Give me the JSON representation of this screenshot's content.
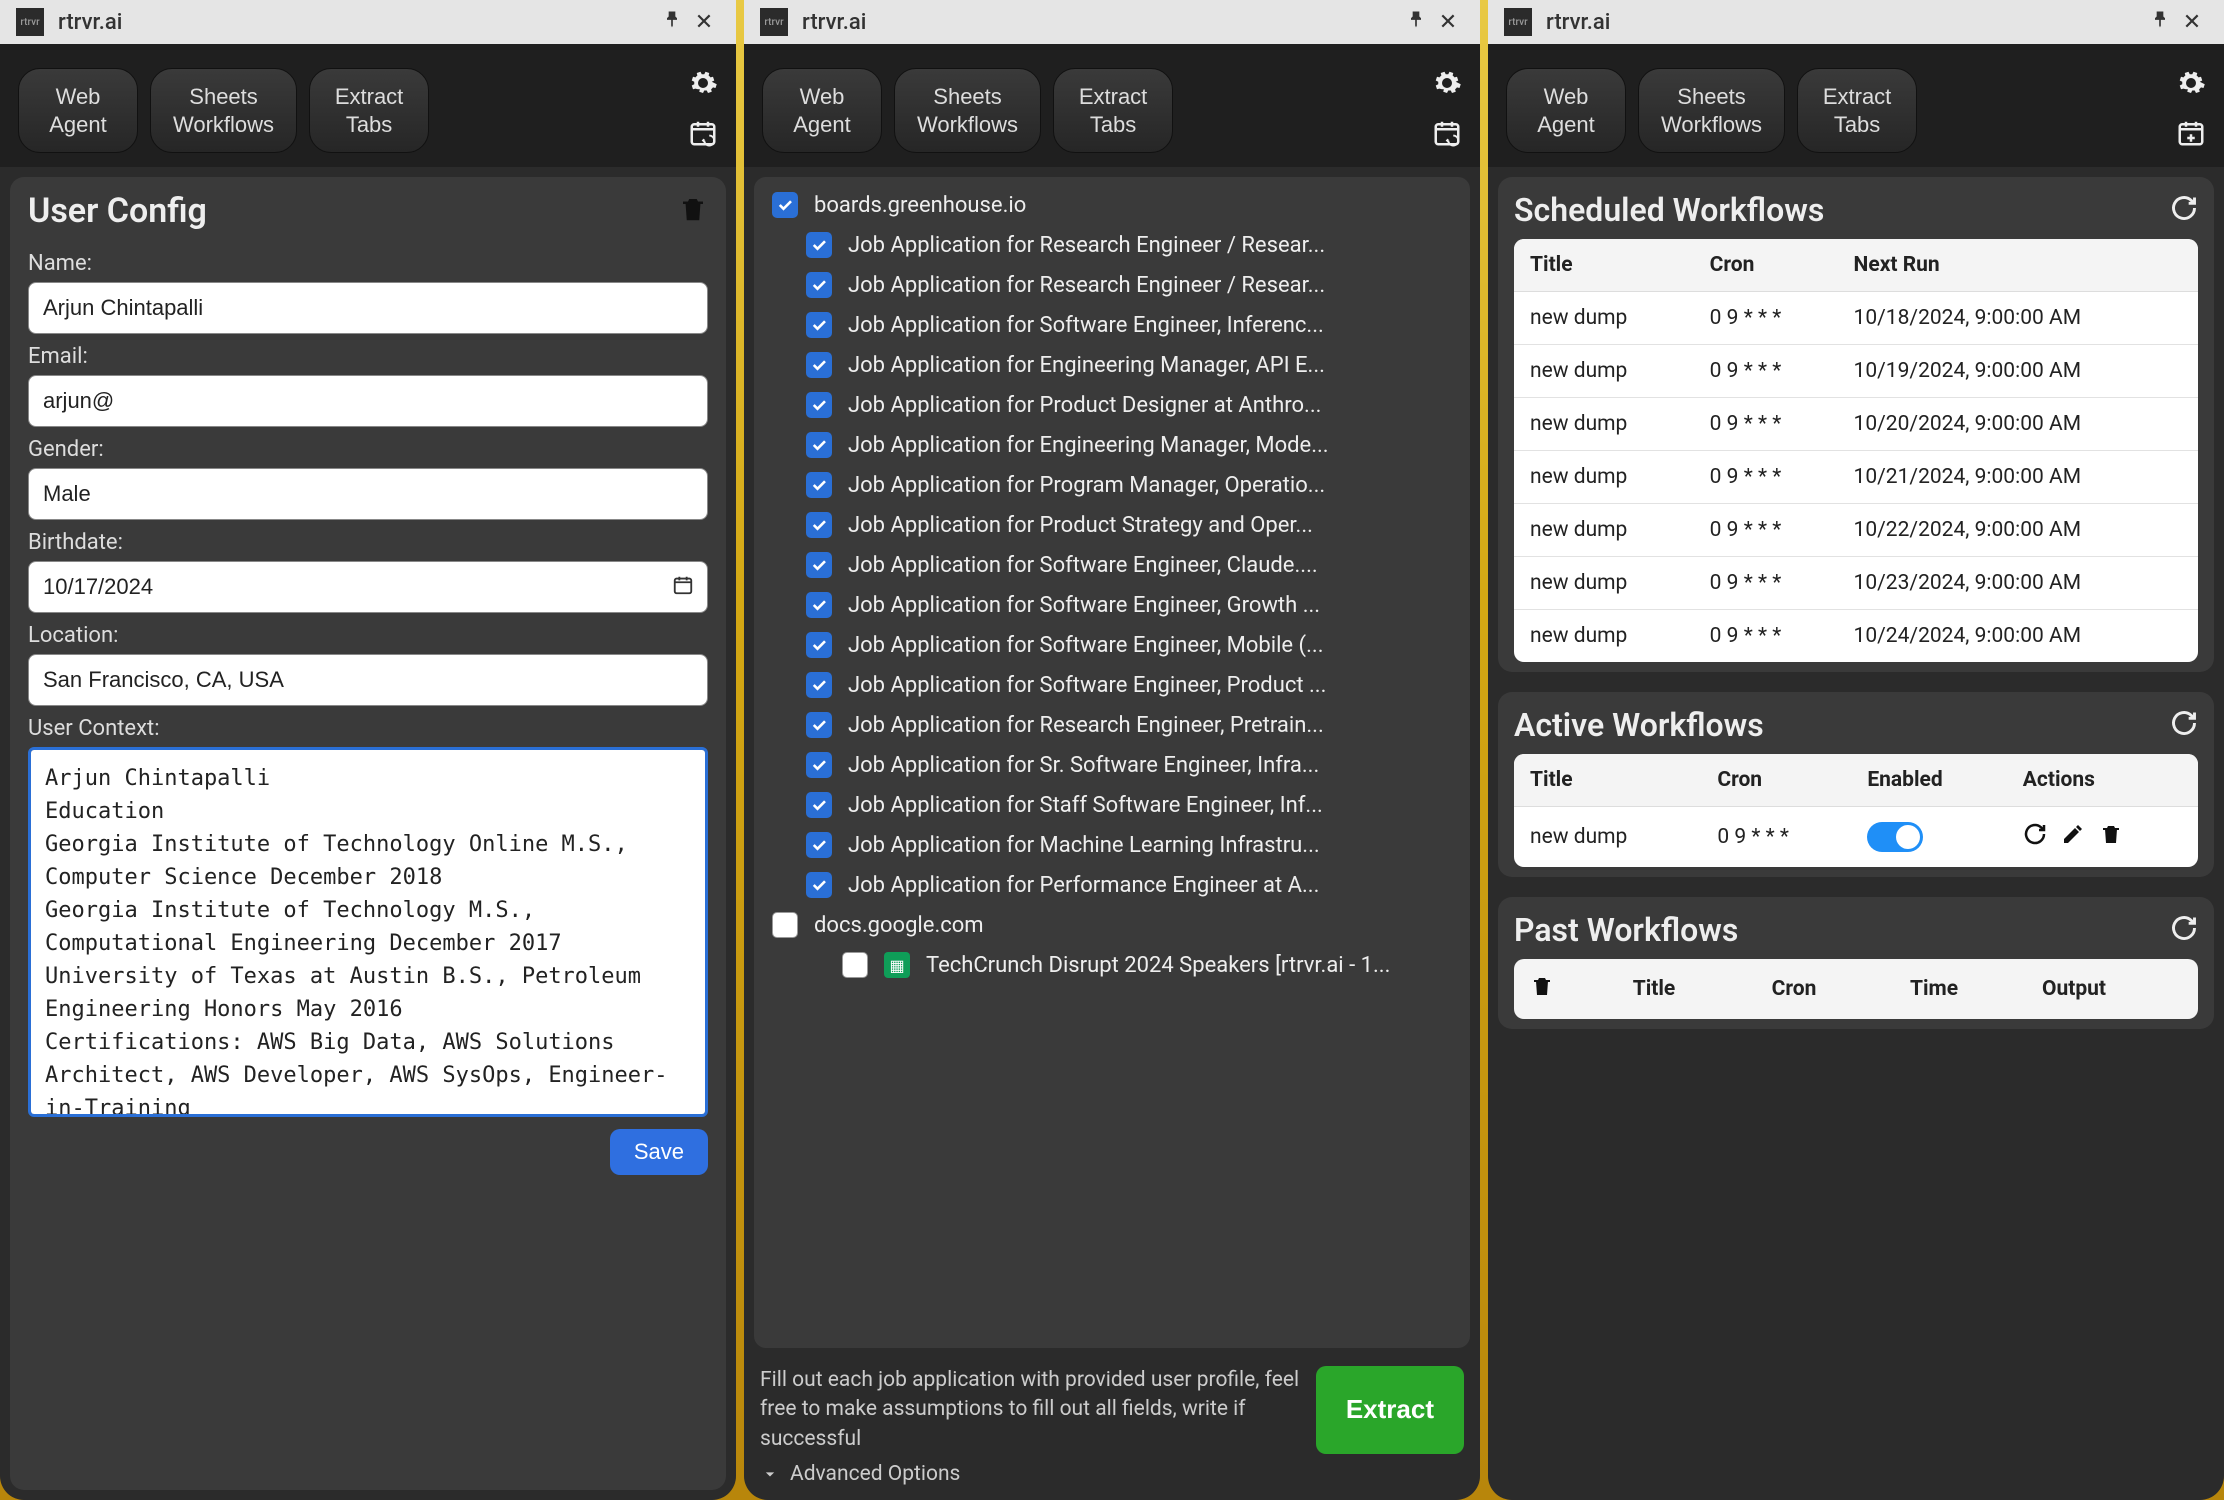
{
  "app_title": "rtrvr.ai",
  "tabs": {
    "web_agent": "Web\nAgent",
    "sheets": "Sheets\nWorkflows",
    "extract": "Extract\nTabs"
  },
  "panel1": {
    "title": "User Config",
    "fields": {
      "name_label": "Name:",
      "name_value": "Arjun Chintapalli",
      "email_label": "Email:",
      "email_value": "arjun@",
      "gender_label": "Gender:",
      "gender_value": "Male",
      "birth_label": "Birthdate:",
      "birth_value": "10/17/2024",
      "location_label": "Location:",
      "location_value": "San Francisco, CA, USA",
      "context_label": "User Context:",
      "context_value": "Arjun Chintapalli\nEducation\nGeorgia Institute of Technology Online M.S., Computer Science December 2018\nGeorgia Institute of Technology M.S., Computational Engineering December 2017\nUniversity of Texas at Austin B.S., Petroleum Engineering Honors May 2016\nCertifications: AWS Big Data, AWS Solutions Architect, AWS Developer, AWS SysOps, Engineer-in-Training"
    },
    "save_label": "Save"
  },
  "panel2": {
    "domain1": "boards.greenhouse.io",
    "items": [
      "Job Application for Research Engineer / Resear...",
      "Job Application for Research Engineer / Resear...",
      "Job Application for Software Engineer, Inferenc...",
      "Job Application for Engineering Manager, API E...",
      "Job Application for Product Designer at Anthro...",
      "Job Application for Engineering Manager, Mode...",
      "Job Application for Program Manager, Operatio...",
      "Job Application for Product Strategy and Oper...",
      "Job Application for Software Engineer, Claude....",
      "Job Application for Software Engineer, Growth ...",
      "Job Application for Software Engineer, Mobile (...",
      "Job Application for Software Engineer, Product ...",
      "Job Application for Research Engineer, Pretrain...",
      "Job Application for Sr. Software Engineer, Infra...",
      "Job Application for Staff Software Engineer, Inf...",
      "Job Application for Machine Learning Infrastru...",
      "Job Application for Performance Engineer at A..."
    ],
    "domain2": "docs.google.com",
    "doc_item": "TechCrunch Disrupt 2024 Speakers [rtrvr.ai - 1...",
    "instruction": "Fill out each job application with provided user profile, feel free to make assumptions to fill out all fields, write if successful",
    "extract_label": "Extract",
    "advanced_label": "Advanced Options"
  },
  "panel3": {
    "scheduled": {
      "title": "Scheduled Workflows",
      "cols": {
        "title": "Title",
        "cron": "Cron",
        "next": "Next Run"
      },
      "rows": [
        {
          "title": "new dump",
          "cron": "0 9 * * *",
          "next": "10/18/2024, 9:00:00 AM"
        },
        {
          "title": "new dump",
          "cron": "0 9 * * *",
          "next": "10/19/2024, 9:00:00 AM"
        },
        {
          "title": "new dump",
          "cron": "0 9 * * *",
          "next": "10/20/2024, 9:00:00 AM"
        },
        {
          "title": "new dump",
          "cron": "0 9 * * *",
          "next": "10/21/2024, 9:00:00 AM"
        },
        {
          "title": "new dump",
          "cron": "0 9 * * *",
          "next": "10/22/2024, 9:00:00 AM"
        },
        {
          "title": "new dump",
          "cron": "0 9 * * *",
          "next": "10/23/2024, 9:00:00 AM"
        },
        {
          "title": "new dump",
          "cron": "0 9 * * *",
          "next": "10/24/2024, 9:00:00 AM"
        }
      ]
    },
    "active": {
      "title": "Active Workflows",
      "cols": {
        "title": "Title",
        "cron": "Cron",
        "enabled": "Enabled",
        "actions": "Actions"
      },
      "row": {
        "title": "new dump",
        "cron": "0 9 * * *"
      }
    },
    "past": {
      "title": "Past Workflows",
      "cols": {
        "title": "Title",
        "cron": "Cron",
        "time": "Time",
        "output": "Output"
      }
    }
  }
}
